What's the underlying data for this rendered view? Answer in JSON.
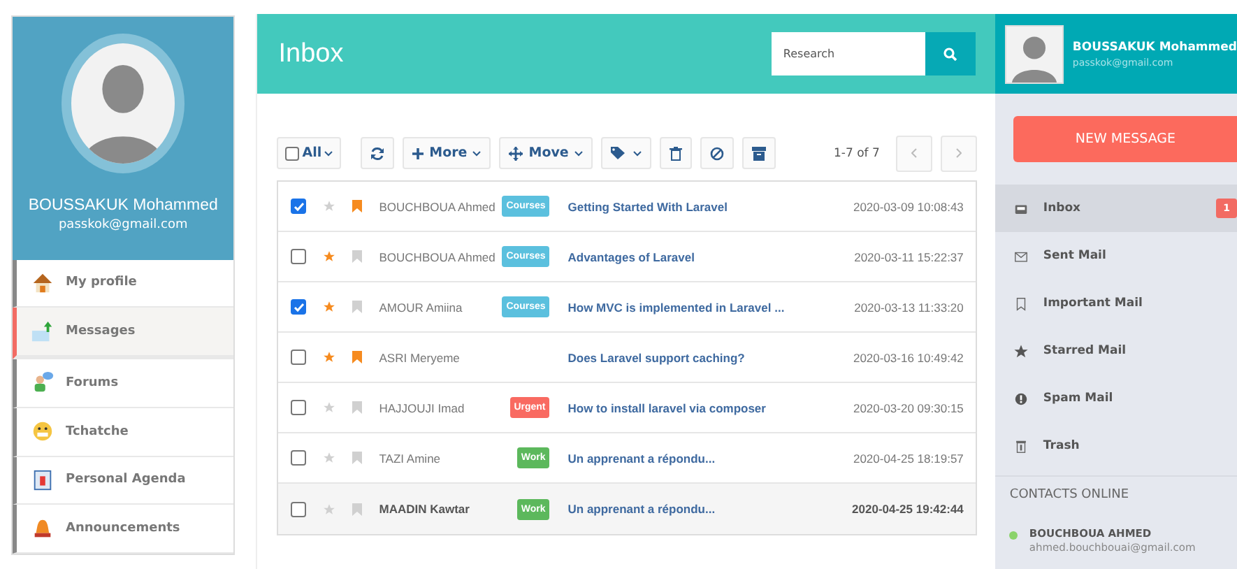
{
  "profile": {
    "name": "BOUSSAKUK Mohammed",
    "email": "passkok@gmail.com"
  },
  "menu": [
    {
      "label": "My profile",
      "selected": false
    },
    {
      "label": "Messages",
      "selected": true
    },
    {
      "label": "Forums",
      "selected": false
    },
    {
      "label": "Tchatche",
      "selected": false
    },
    {
      "label": "Personal Agenda",
      "selected": false
    },
    {
      "label": "Announcements",
      "selected": false
    }
  ],
  "header": {
    "title": "Inbox",
    "search": {
      "placeholder": "Research"
    }
  },
  "toolbar": {
    "select_all": {
      "label": "All",
      "checked": false
    },
    "more": "More",
    "move": "Move",
    "pagination": "1-7 of 7"
  },
  "messages": [
    {
      "checked": true,
      "starred": false,
      "important": true,
      "unread": false,
      "sender": "BOUCHBOUA Ahmed",
      "tag": {
        "label": "Courses",
        "color": "#5bc0de"
      },
      "subject": "Getting Started With Laravel",
      "date": "2020-03-09 10:08:43"
    },
    {
      "checked": false,
      "starred": true,
      "important": false,
      "unread": false,
      "sender": "BOUCHBOUA Ahmed",
      "tag": {
        "label": "Courses",
        "color": "#5bc0de"
      },
      "subject": "Advantages of Laravel",
      "date": "2020-03-11 15:22:37"
    },
    {
      "checked": true,
      "starred": true,
      "important": false,
      "unread": false,
      "sender": "AMOUR Amiina",
      "tag": {
        "label": "Courses",
        "color": "#5bc0de"
      },
      "subject": "How MVC is implemented in Laravel ...",
      "date": "2020-03-13 11:33:20"
    },
    {
      "checked": false,
      "starred": true,
      "important": true,
      "unread": false,
      "sender": "ASRI Meryeme",
      "subject": "Does Laravel support caching?",
      "date": "2020-03-16 10:49:42"
    },
    {
      "checked": false,
      "starred": false,
      "important": false,
      "unread": false,
      "sender": "HAJJOUJI Imad",
      "tag": {
        "label": "Urgent",
        "color": "#f96a61"
      },
      "subject": "How to install laravel via composer",
      "date": "2020-03-20 09:30:15"
    },
    {
      "checked": false,
      "starred": false,
      "important": false,
      "unread": false,
      "sender": "TAZI Amine",
      "tag": {
        "label": "Work",
        "color": "#5cb85c"
      },
      "subject": "Un apprenant a répondu...",
      "date": "2020-04-25 18:19:57"
    },
    {
      "checked": false,
      "starred": false,
      "important": false,
      "unread": true,
      "sender": "MAADIN Kawtar",
      "tag": {
        "label": "Work",
        "color": "#5cb85c"
      },
      "subject": "Un apprenant a répondu...",
      "date": "2020-04-25 19:42:44"
    }
  ],
  "account": {
    "name": "BOUSSAKUK Mohammed",
    "email": "passkok@gmail.com"
  },
  "new_message": "NEW MESSAGE",
  "folders": [
    {
      "label": "Inbox",
      "selected": true,
      "badge": "1"
    },
    {
      "label": "Sent Mail",
      "selected": false
    },
    {
      "label": "Important Mail",
      "selected": false
    },
    {
      "label": "Starred Mail",
      "selected": false
    },
    {
      "label": "Spam Mail",
      "selected": false
    },
    {
      "label": "Trash",
      "selected": false
    }
  ],
  "contacts_title": "CONTACTS ONLINE",
  "contacts": [
    {
      "name": "BOUCHBOUA AHMED",
      "email": "ahmed.bouchbouai@gmail.com",
      "color": "#8bd36b"
    }
  ]
}
